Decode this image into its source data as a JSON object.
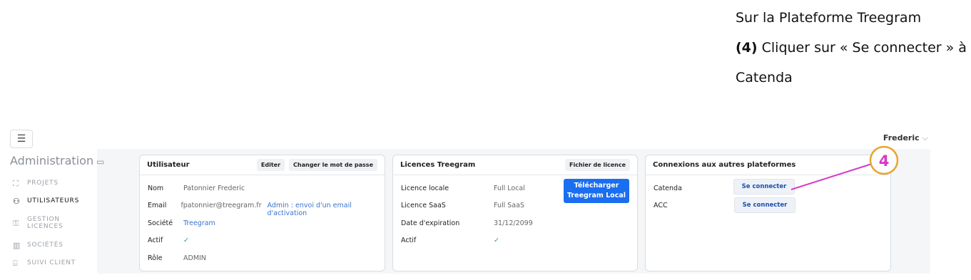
{
  "instruction": {
    "line1": "Sur la Plateforme Treegram",
    "step_number": "(4)",
    "line2_rest": " Cliquer sur « Se connecter » à",
    "line3": "Catenda"
  },
  "header": {
    "user_name": "Frederic",
    "menu_icon": "hamburger-icon",
    "chevron": "chevron-down-icon"
  },
  "sidebar": {
    "title": "Administration",
    "items": [
      {
        "label": "PROJETS",
        "icon": "projects-icon",
        "active": false
      },
      {
        "label": "UTILISATEURS",
        "icon": "users-icon",
        "active": true
      },
      {
        "label": "GESTION\nLICENCES",
        "icon": "license-icon",
        "active": false
      },
      {
        "label": "SOCIÉTÉS",
        "icon": "company-icon",
        "active": false
      },
      {
        "label": "SUIVI CLIENT",
        "icon": "client-tracking-icon",
        "active": false
      }
    ]
  },
  "user_card": {
    "title": "Utilisateur",
    "edit_label": "Editer",
    "change_pwd_label": "Changer le mot de passe",
    "rows": [
      {
        "key": "Nom",
        "value": "Patonnier Frederic"
      },
      {
        "key": "Email",
        "value": "fpatonnier@treegram.fr",
        "link": "Admin : envoi d'un email d'activation"
      },
      {
        "key": "Société",
        "value": "Treegram"
      },
      {
        "key": "Actif",
        "value": "✓"
      },
      {
        "key": "Rôle",
        "value": "ADMIN"
      }
    ]
  },
  "licence_card": {
    "title": "Licences Treegram",
    "file_label": "Fichier de licence",
    "download_label_1": "Télécharger",
    "download_label_2": "Treegram Local",
    "rows": [
      {
        "key": "Licence locale",
        "value": "Full Local"
      },
      {
        "key": "Licence SaaS",
        "value": "Full SaaS"
      },
      {
        "key": "Date d'expiration",
        "value": "31/12/2099"
      },
      {
        "key": "Actif",
        "value": "✓"
      }
    ]
  },
  "connections_card": {
    "title": "Connexions aux autres plateformes",
    "rows": [
      {
        "key": "Catenda",
        "button": "Se connecter"
      },
      {
        "key": "ACC",
        "button": "Se connecter"
      }
    ]
  },
  "annotation": {
    "label": "4",
    "color": "#d63ac8"
  }
}
